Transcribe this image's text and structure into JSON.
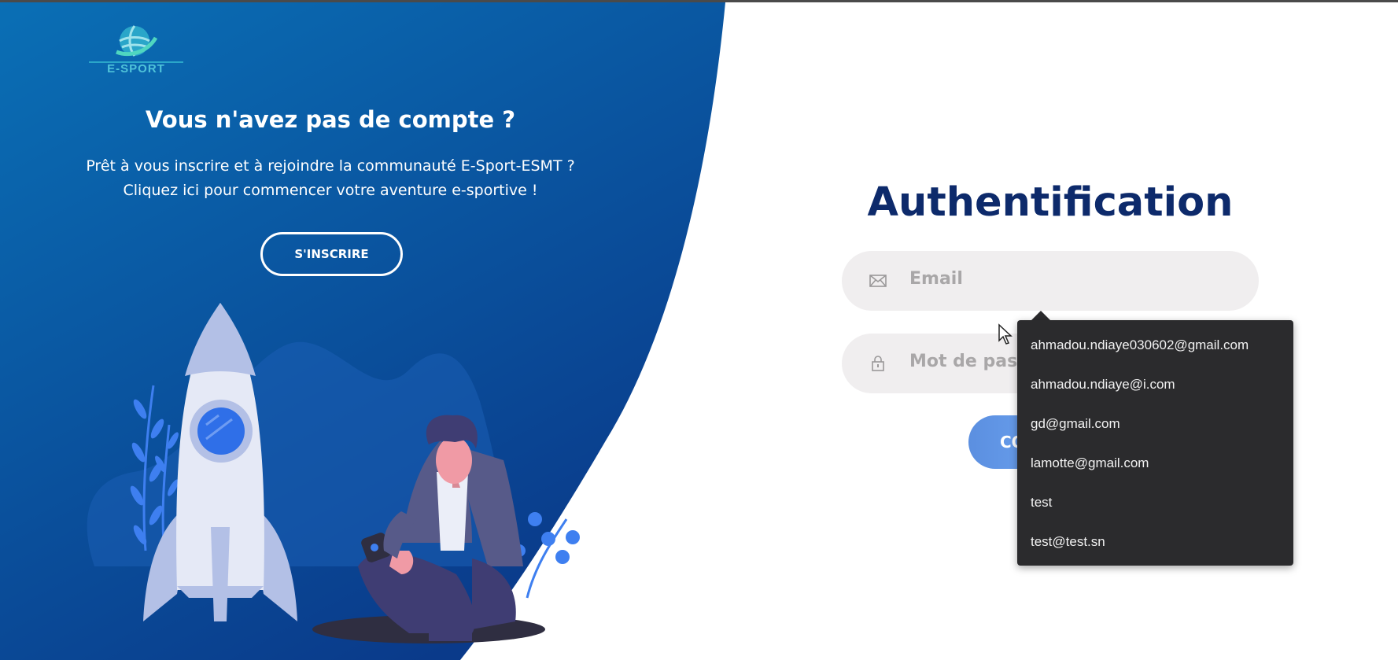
{
  "colors": {
    "left_panel_top": "#0a6fb5",
    "left_panel_bottom": "#0a3a8a",
    "title_navy": "#0d2a6b",
    "input_bg": "#f0eeef",
    "dropdown_bg": "#2b2b2d",
    "button_blue": "#5b8fe0"
  },
  "logo": {
    "text": "E-SPORT",
    "icon": "globe-logo-icon"
  },
  "left_panel": {
    "title": "Vous n'avez pas de compte ?",
    "text_line1": "Prêt à vous inscrire et à rejoindre la communauté E-Sport-ESMT ?",
    "text_line2": "Cliquez ici pour commencer votre aventure e-sportive !",
    "signup_label": "S'INSCRIRE",
    "illustration": "rocket-and-gamer-illustration"
  },
  "auth": {
    "title": "Authentification",
    "email_placeholder": "Email",
    "email_icon": "envelope-icon",
    "password_placeholder": "Mot de passe",
    "password_icon": "lock-icon",
    "login_label_visible": "CO"
  },
  "autocomplete": {
    "items": [
      "ahmadou.ndiaye030602@gmail.com",
      "ahmadou.ndiaye@i.com",
      "gd@gmail.com",
      "lamotte@gmail.com",
      "test",
      "test@test.sn"
    ]
  }
}
